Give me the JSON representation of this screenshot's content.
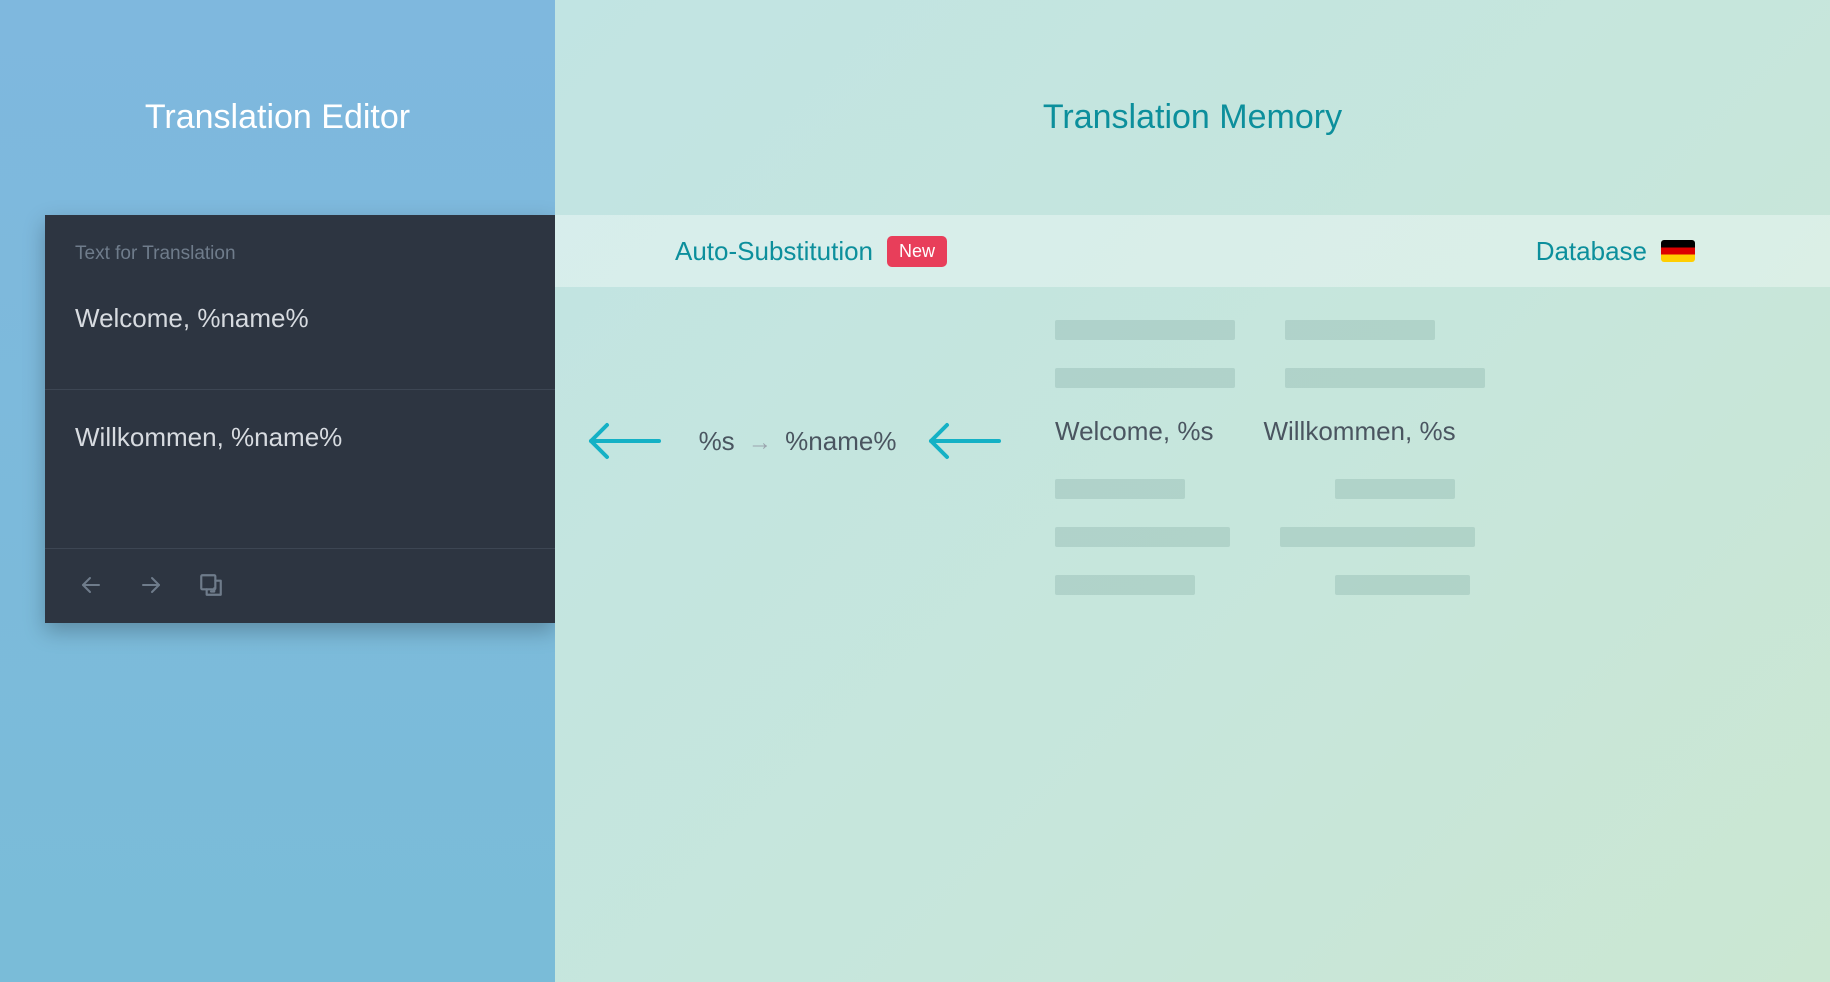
{
  "left": {
    "title": "Translation Editor",
    "editor": {
      "header": "Text for Translation",
      "source": "Welcome, %name%",
      "target": "Willkommen, %name%"
    }
  },
  "right": {
    "title": "Translation Memory",
    "auto_sub": {
      "label": "Auto-Substitution",
      "badge": "New",
      "from": "%s",
      "to": "%name%"
    },
    "database": {
      "label": "Database",
      "source": "Welcome, %s",
      "target": "Willkommen, %s",
      "flag": "de"
    }
  }
}
